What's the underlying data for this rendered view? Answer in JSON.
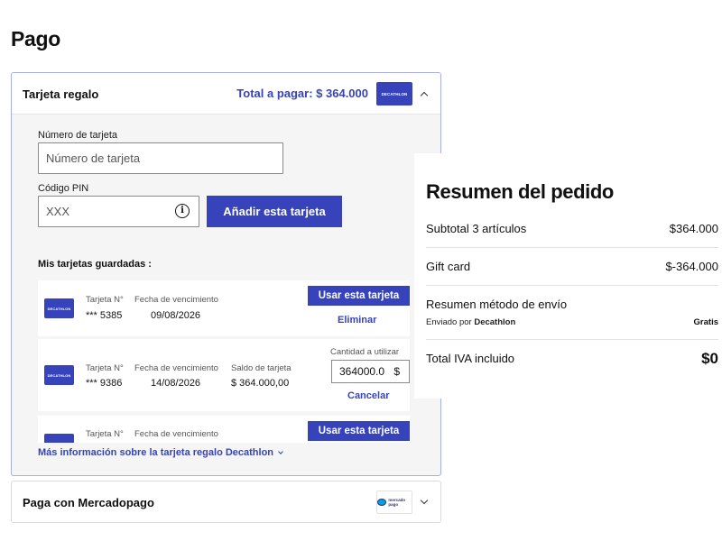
{
  "page": {
    "title": "Pago"
  },
  "colors": {
    "brand": "#3643ba",
    "border_active": "#a6aee6",
    "panel_bg": "#f5f5f5"
  },
  "gift_card": {
    "header_label": "Tarjeta regalo",
    "total_label": "Total a pagar: $ 364.000",
    "logo_text": "DECATHLON",
    "card_number_label": "Número de tarjeta",
    "card_number_placeholder": "Número de tarjeta",
    "card_number_value": "",
    "pin_label": "Código PIN",
    "pin_placeholder": "XXX",
    "pin_value": "",
    "add_button": "Añadir esta tarjeta",
    "saved_title": "Mis tarjetas guardadas :",
    "cards": [
      {
        "number_label": "Tarjeta N°",
        "number": "*** 5385",
        "expiry_label": "Fecha de vencimiento",
        "expiry": "09/08/2026",
        "use_button": "Usar esta tarjeta",
        "remove_link": "Eliminar"
      },
      {
        "number_label": "Tarjeta N°",
        "number": "*** 9386",
        "expiry_label": "Fecha de vencimiento",
        "expiry": "14/08/2026",
        "balance_label": "Saldo de tarjeta",
        "balance": "$ 364.000,00",
        "amount_label": "Cantidad a utilizar",
        "amount_value": "364000.0",
        "amount_currency": "$",
        "cancel_link": "Cancelar"
      },
      {
        "number_label": "Tarjeta N°",
        "expiry_label": "Fecha de vencimiento",
        "use_button": "Usar esta tarjeta"
      }
    ],
    "more_info_link": "Más información sobre la tarjeta regalo Decathlon"
  },
  "mercadopago": {
    "label": "Paga con Mercadopago",
    "logo_text": "mercado pago"
  },
  "summary": {
    "title": "Resumen del pedido",
    "subtotal_label": "Subtotal 3 artículos",
    "subtotal_value": "$364.000",
    "giftcard_label": "Gift card",
    "giftcard_value": "$-364.000",
    "shipping_title": "Resumen método de envío",
    "shipping_by_prefix": "Enviado por",
    "shipping_by_name": "Decathlon",
    "shipping_cost": "Gratis",
    "total_label": "Total IVA incluido",
    "total_value": "$0"
  }
}
